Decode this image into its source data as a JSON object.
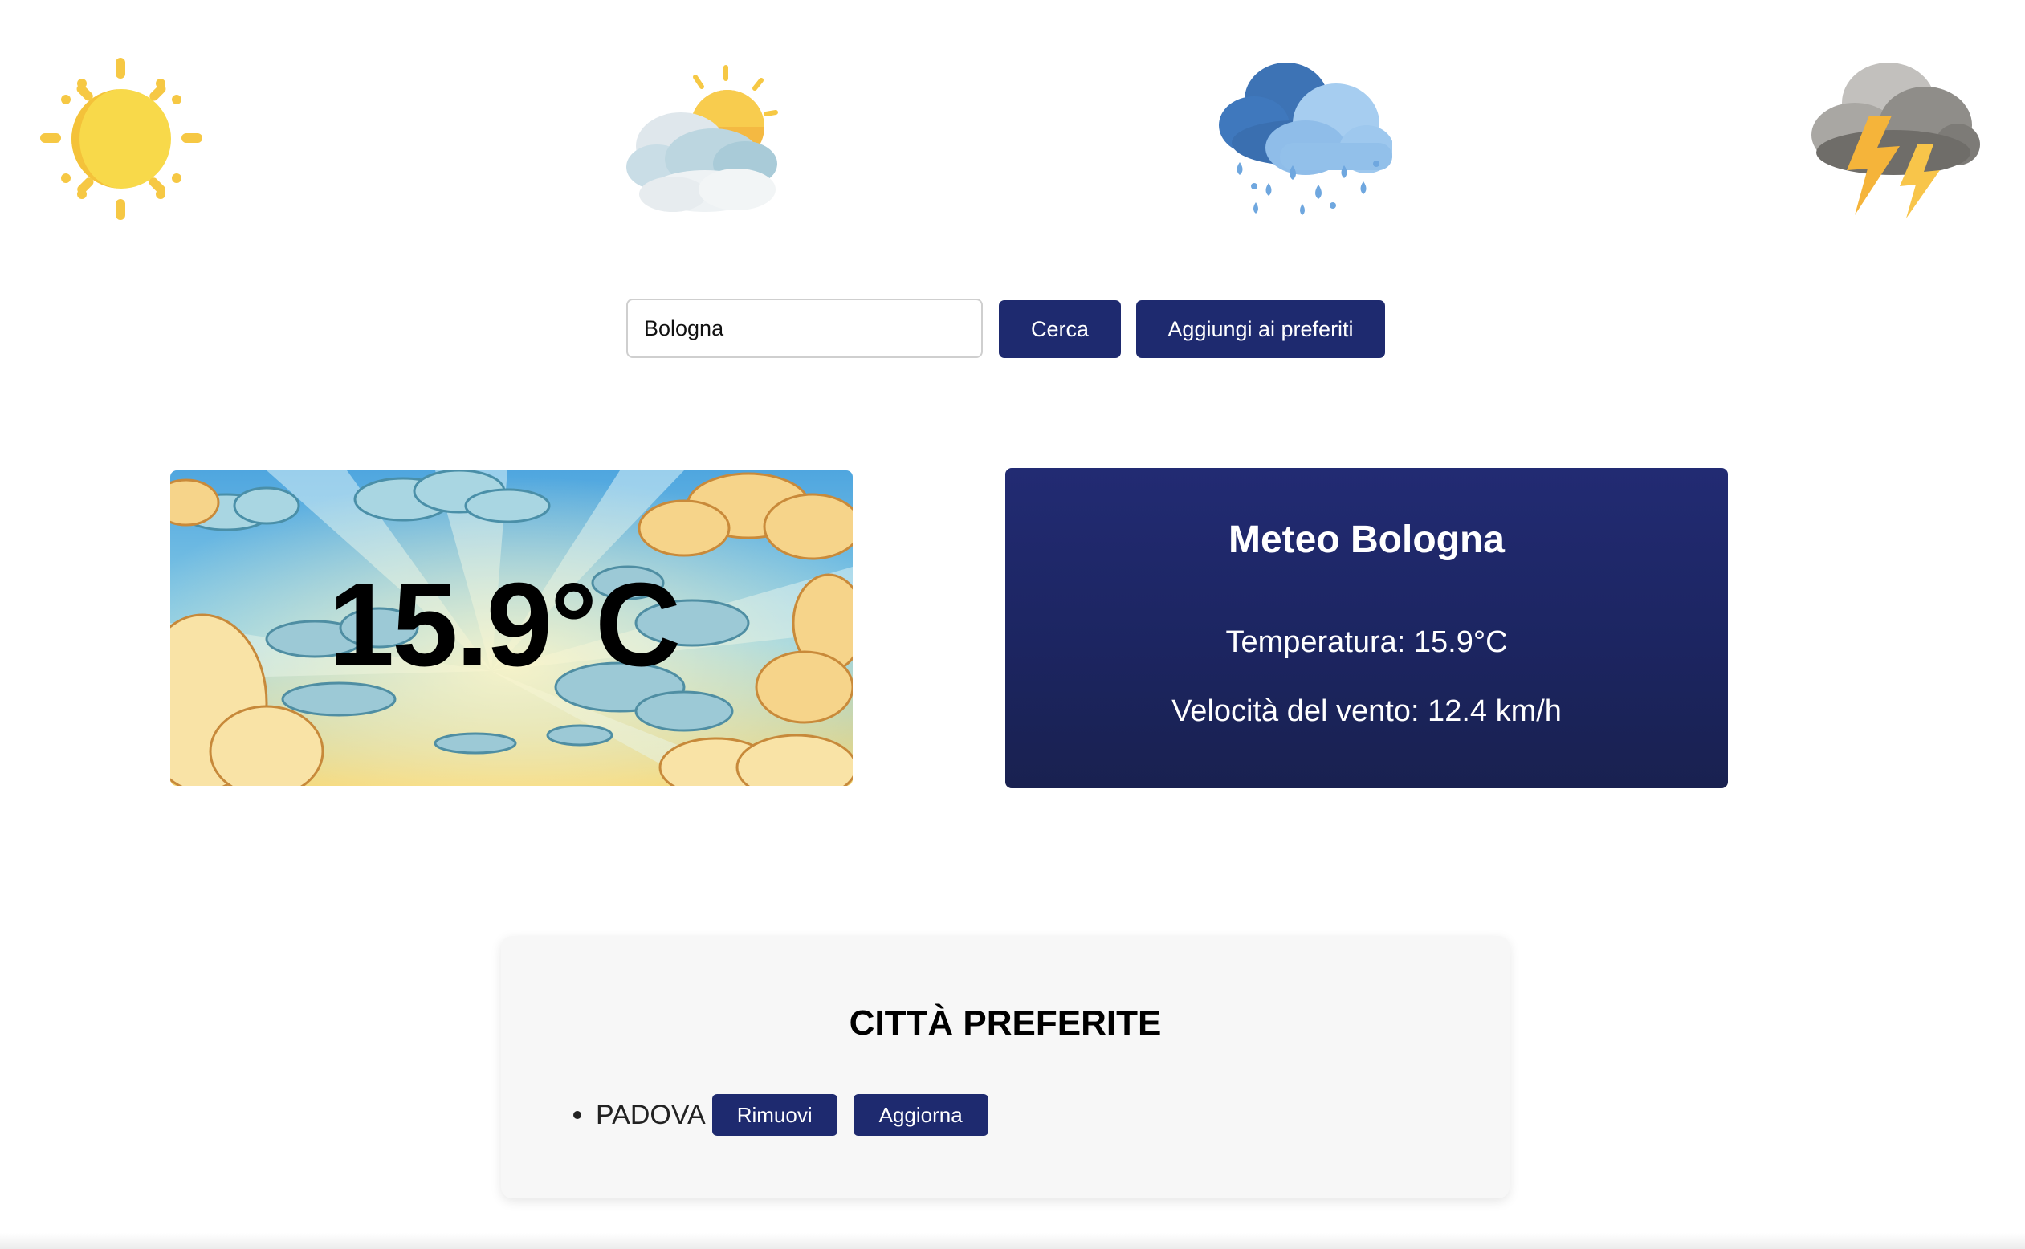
{
  "weather_icons": [
    {
      "name": "sun-icon"
    },
    {
      "name": "partly-cloudy-icon"
    },
    {
      "name": "rain-cloud-icon"
    },
    {
      "name": "thunderstorm-icon"
    }
  ],
  "search": {
    "value": "Bologna",
    "search_button": "Cerca",
    "add_favorite_button": "Aggiungi ai preferiti"
  },
  "temp_card": {
    "temperature": "15.9°C"
  },
  "info_card": {
    "title": "Meteo Bologna",
    "temperature_line": "Temperatura: 15.9°C",
    "wind_line": "Velocità del vento: 12.4 km/h"
  },
  "favorites": {
    "title": "CITTÀ PREFERITE",
    "items": [
      {
        "name": "PADOVA",
        "remove_label": "Rimuovi",
        "refresh_label": "Aggiorna"
      }
    ]
  },
  "colors": {
    "button_bg": "#1e2a6f",
    "info_card_bg": "#1f2868",
    "panel_bg": "#f7f7f7"
  }
}
